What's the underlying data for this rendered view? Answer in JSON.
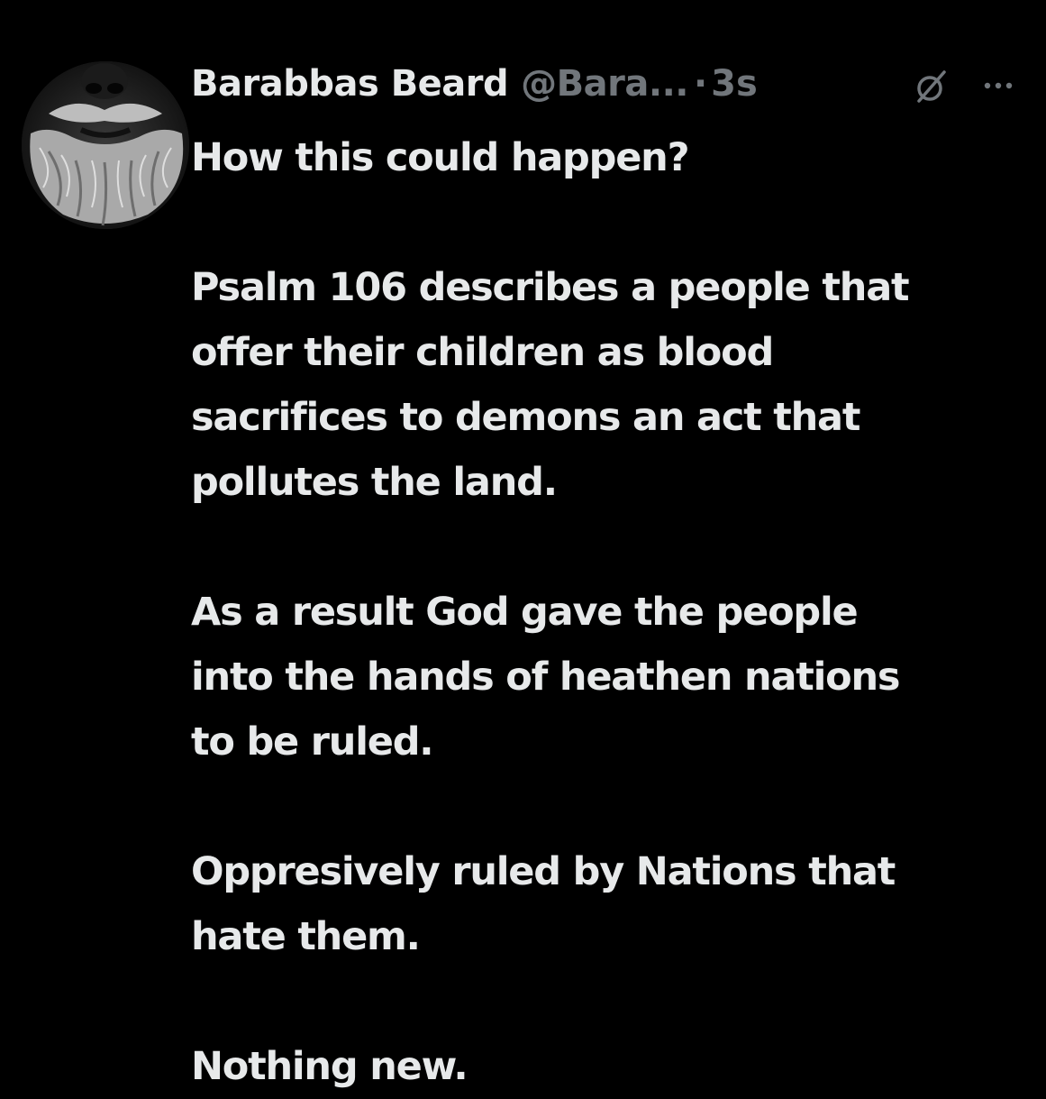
{
  "post": {
    "display_name": "Barabbas Beard",
    "handle": "@Bara...",
    "separator": "·",
    "timestamp": "3s",
    "paragraphs": [
      "How this could happen?",
      "Psalm 106 describes a people that\noffer their children as blood\nsacrifices to demons an act that\npollutes the land.",
      "As a result God gave the people\ninto the hands of heathen nations\nto be ruled.",
      "Oppresively ruled by Nations that\nhate them.",
      "Nothing new."
    ]
  },
  "icons": {
    "grok": "grok-icon",
    "more": "more-options-icon"
  },
  "colors": {
    "background": "#000000",
    "primary_text": "#e7e9ea",
    "secondary_text": "#71767b"
  }
}
